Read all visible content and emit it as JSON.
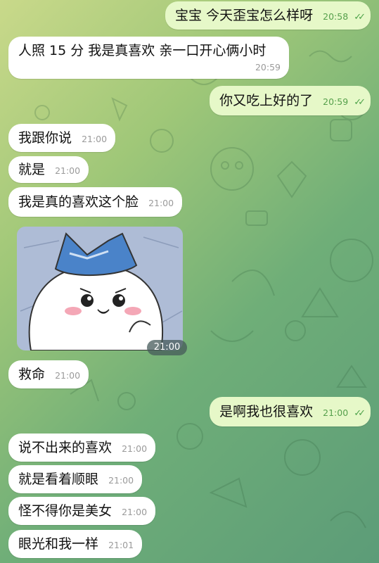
{
  "messages": [
    {
      "text": "宝宝 今天歪宝怎么样呀",
      "time": "20:58"
    },
    {
      "text": "人照 15 分 我是真喜欢 亲一口开心俩小时",
      "time": "20:59"
    },
    {
      "text": "你又吃上好的了",
      "time": "20:59"
    },
    {
      "text": "我跟你说",
      "time": "21:00"
    },
    {
      "text": "就是",
      "time": "21:00"
    },
    {
      "text": "我是真的喜欢这个脸",
      "time": "21:00"
    },
    {
      "time": "21:00"
    },
    {
      "text": "救命",
      "time": "21:00"
    },
    {
      "text": "是啊我也很喜欢",
      "time": "21:00"
    },
    {
      "text": "说不出来的喜欢",
      "time": "21:00"
    },
    {
      "text": "就是看着顺眼",
      "time": "21:00"
    },
    {
      "text": "怪不得你是美女",
      "time": "21:00"
    },
    {
      "text": "眼光和我一样",
      "time": "21:01"
    }
  ],
  "read_ticks": "✓✓",
  "colors": {
    "incoming": "#ffffff",
    "outgoing": "#e6f8c8",
    "tick": "#4ea34a"
  }
}
